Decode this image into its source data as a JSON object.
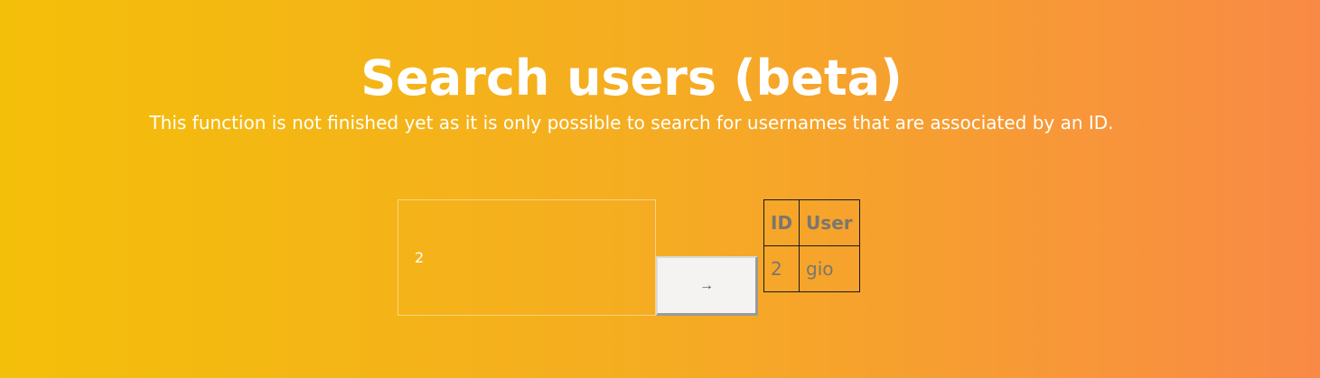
{
  "page": {
    "title": "Search users (beta)",
    "subtitle": "This function is not finished yet as it is only possible to search for usernames that are associated by an ID."
  },
  "search": {
    "value": "2",
    "button_icon": "arrow-right-icon",
    "button_glyph": "→"
  },
  "results": {
    "headers": [
      "ID",
      "User"
    ],
    "rows": [
      [
        "2",
        "gio"
      ]
    ]
  },
  "colors": {
    "gradient_start": "#f4bf09",
    "gradient_end": "#f98a46",
    "text": "#ffffff",
    "table_text": "#7a7670"
  }
}
